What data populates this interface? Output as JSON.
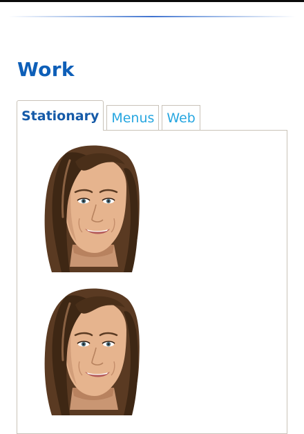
{
  "page": {
    "title": "Work"
  },
  "tabs": [
    {
      "label": "Stationary",
      "active": true
    },
    {
      "label": "Menus",
      "active": false
    },
    {
      "label": "Web",
      "active": false
    }
  ],
  "gallery": {
    "items": [
      {
        "icon": "woman-portrait-illustration"
      },
      {
        "icon": "woman-portrait-illustration"
      }
    ]
  },
  "colors": {
    "title": "#0e5fb8",
    "tab_active": "#155aa8",
    "tab_inactive": "#26a6e0",
    "border": "#c9c2b8",
    "hair": "#5a3a22",
    "skin": "#e6b48e"
  }
}
